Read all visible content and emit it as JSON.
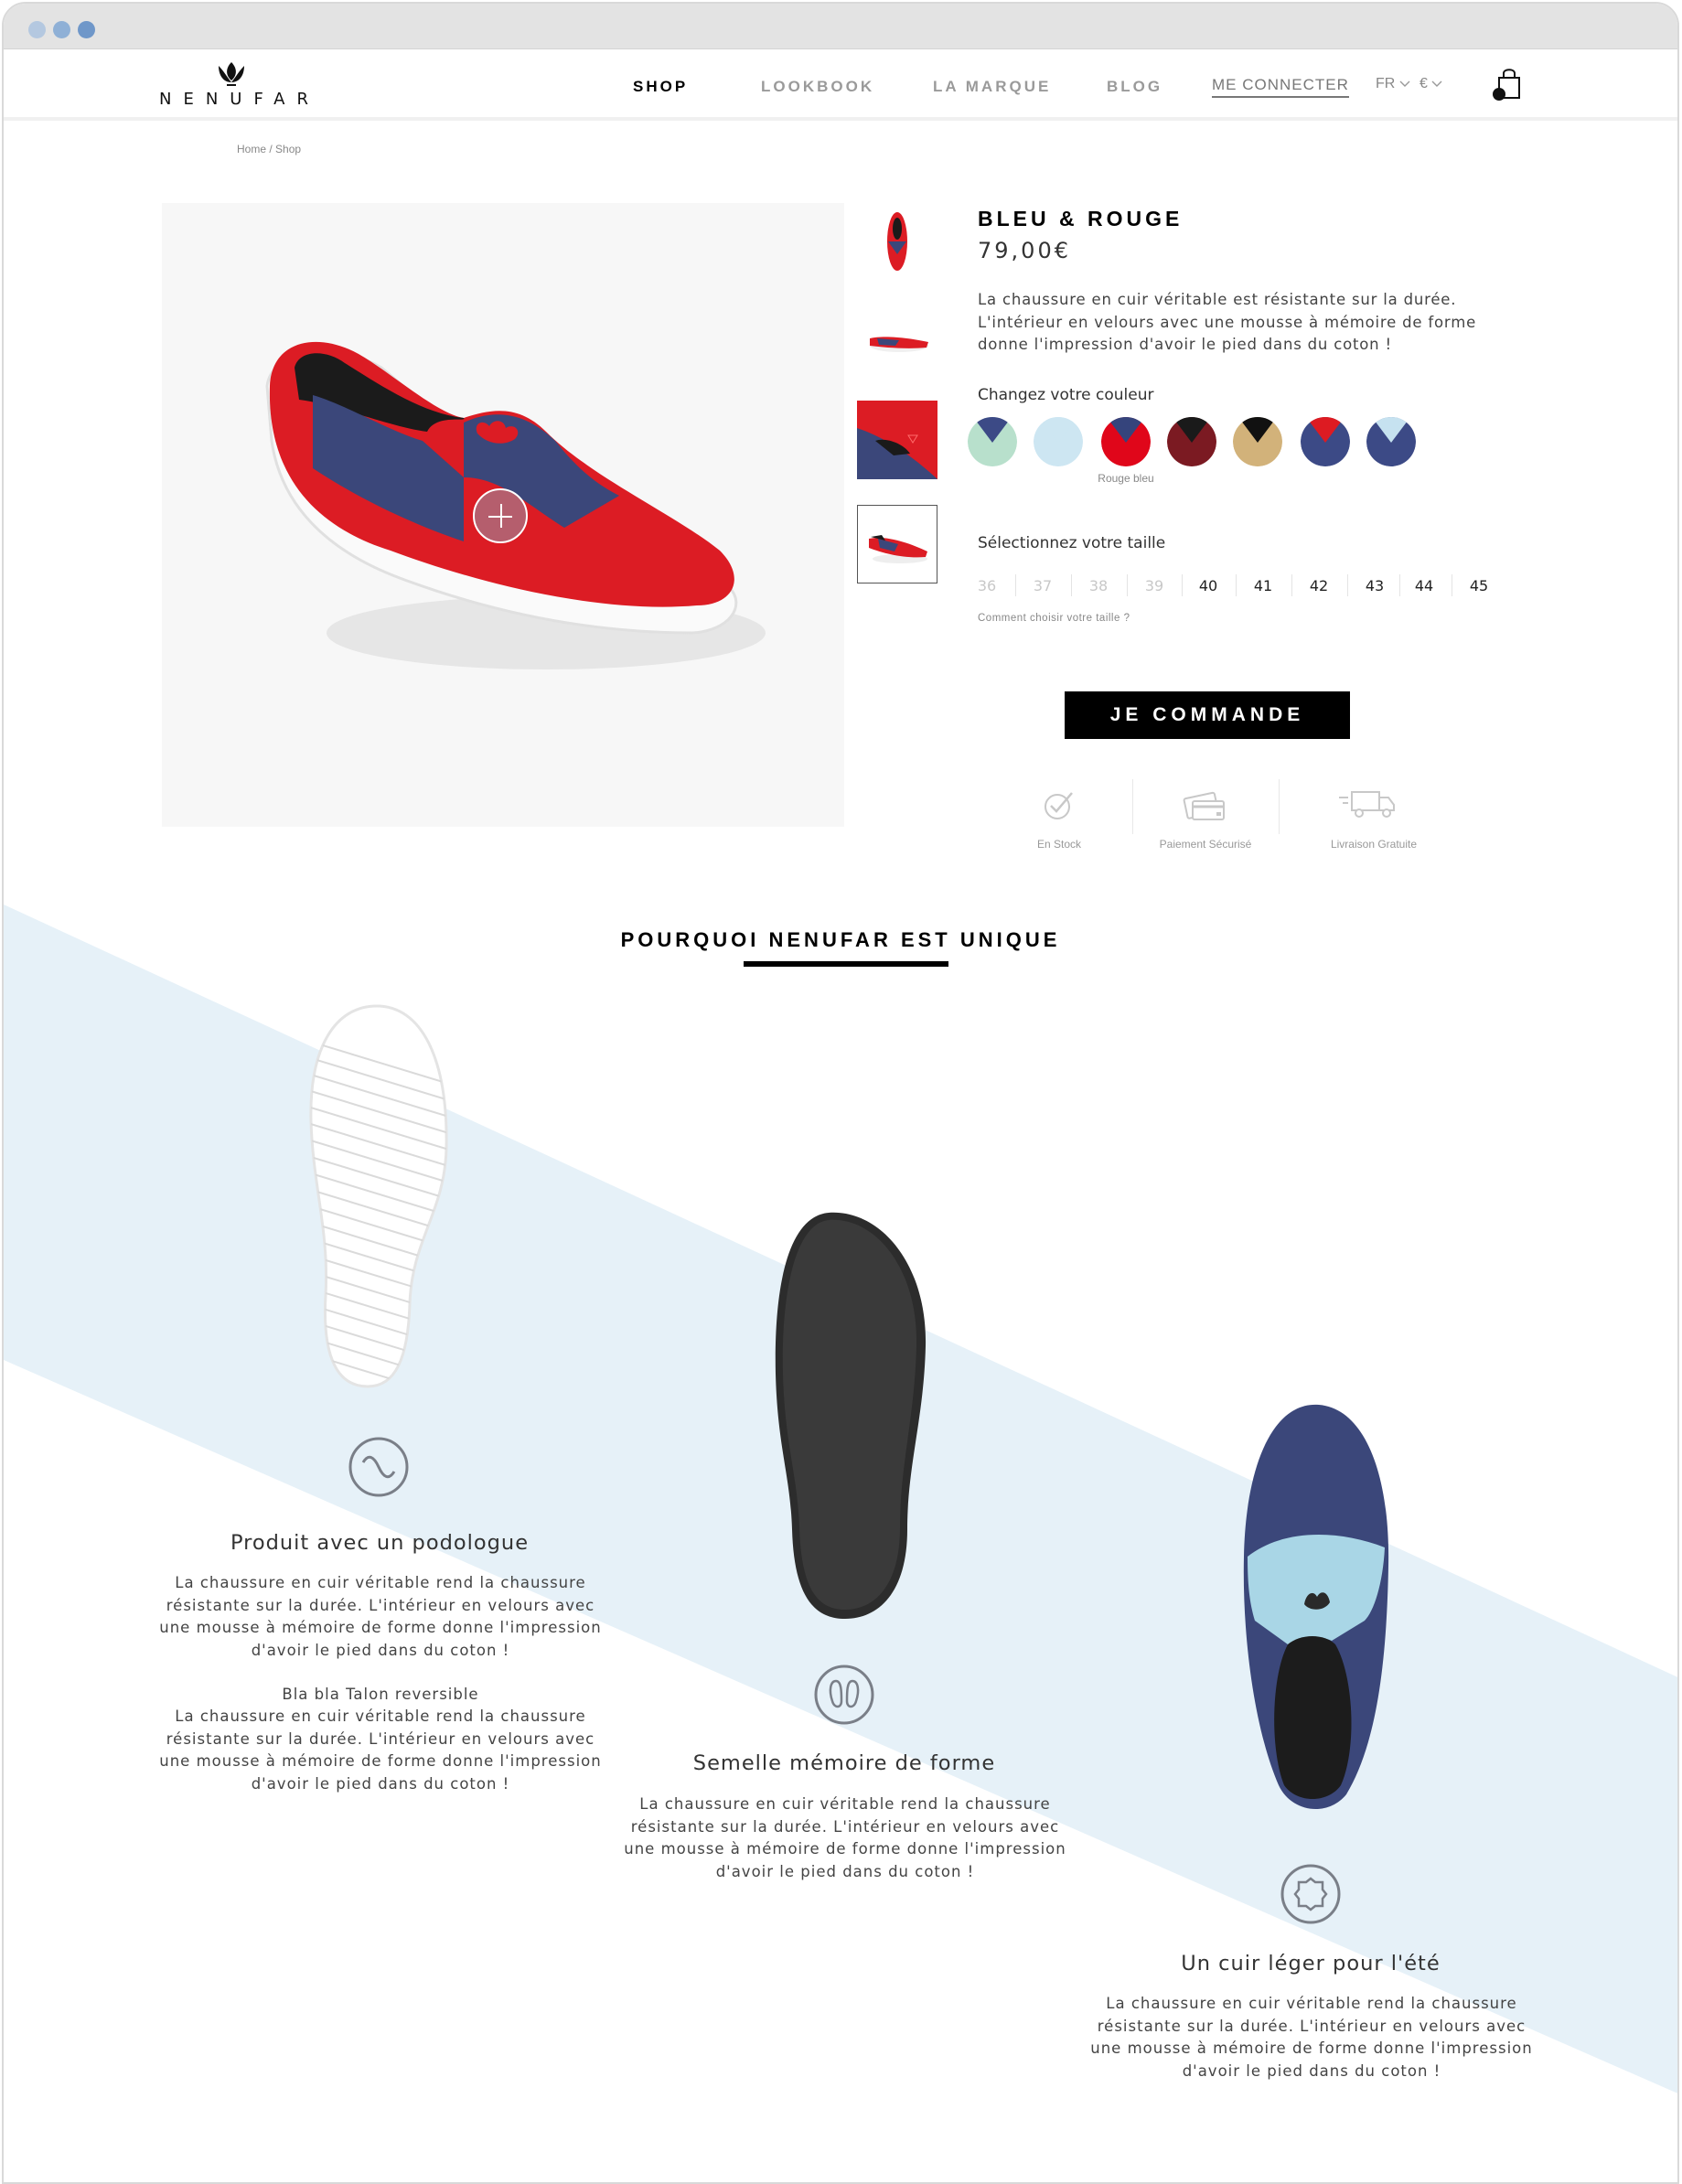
{
  "window": {
    "dot_colors": [
      "#b4c8e0",
      "#8fb0d6",
      "#6f97c9"
    ]
  },
  "brand": {
    "name": "NENUFAR"
  },
  "nav": {
    "items": [
      "SHOP",
      "LOOKBOOK",
      "LA MARQUE",
      "BLOG"
    ],
    "login": "ME CONNECTER",
    "language": "FR",
    "currency": "€"
  },
  "breadcrumb": "Home / Shop",
  "product": {
    "title": "BLEU & ROUGE",
    "price": "79,00€",
    "description": "La chaussure en cuir véritable est résistante sur la durée. L'intérieur en velours avec une mousse à mémoire de forme donne l'impression d'avoir le pied dans du coton !",
    "color_label": "Changez votre couleur",
    "colors": [
      {
        "top": "#3c4a86",
        "bottom": "#b8e0cc"
      },
      {
        "top": "#cde6f2",
        "bottom": "#cde6f2"
      },
      {
        "top": "#35447c",
        "bottom": "#e0061a"
      },
      {
        "top": "#1a1a1a",
        "bottom": "#7b1a22"
      },
      {
        "top": "#111111",
        "bottom": "#d2b27a"
      },
      {
        "top": "#dd1b22",
        "bottom": "#3c4a86"
      },
      {
        "top": "#c6e2f0",
        "bottom": "#3c4a86"
      }
    ],
    "selected_color_caption": "Rouge bleu",
    "size_label": "Sélectionnez votre taille",
    "sizes_unavailable": [
      "36",
      "37",
      "38",
      "39"
    ],
    "sizes_available": [
      "40",
      "41",
      "42",
      "43",
      "44",
      "45"
    ],
    "size_help": "Comment choisir votre taille ?",
    "cta": "JE COMMANDE",
    "perks": [
      "En Stock",
      "Paiement Sécurisé",
      "Livraison Gratuite"
    ]
  },
  "unique": {
    "title": "POURQUOI NENUFAR EST UNIQUE",
    "features": [
      {
        "title": "Produit avec un podologue",
        "text": "La chaussure en cuir véritable rend la chaussure résistante sur la durée. L'intérieur en velours avec une mousse à mémoire de forme donne l'impression d'avoir le pied dans du coton !",
        "subtitle": "Bla bla Talon reversible",
        "text2": "La chaussure en cuir véritable rend la chaussure résistante sur la durée. L'intérieur en velours avec une mousse à mémoire de forme donne l'impression d'avoir le pied dans du coton !"
      },
      {
        "title": "Semelle mémoire de forme",
        "text": "La chaussure en cuir véritable rend la chaussure résistante sur la durée. L'intérieur en velours avec une mousse à mémoire de forme donne l'impression d'avoir le pied dans du coton !"
      },
      {
        "title": "Un cuir léger pour l'été",
        "text": "La chaussure en cuir véritable rend la chaussure résistante sur la durée. L'intérieur en velours avec une mousse à mémoire de forme donne l'impression d'avoir le pied dans du coton !"
      }
    ]
  }
}
